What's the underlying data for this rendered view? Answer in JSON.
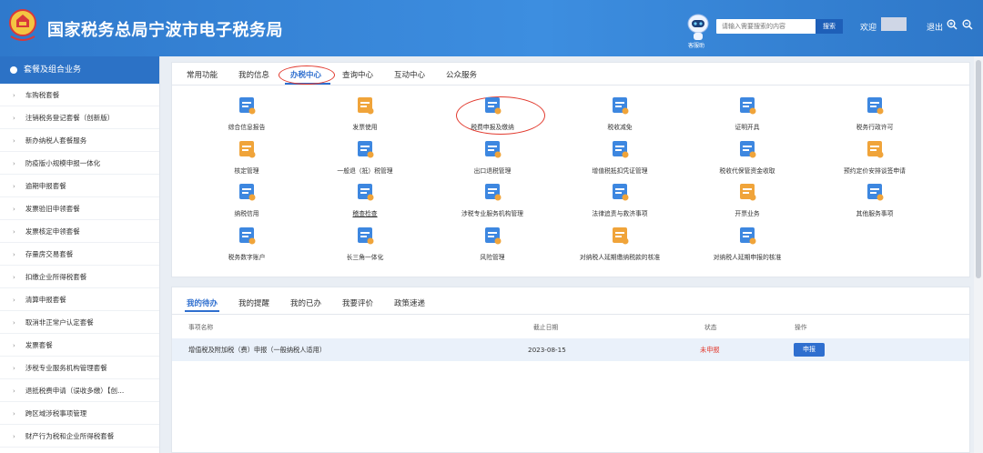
{
  "header": {
    "title": "国家税务总局宁波市电子税务局",
    "robot_label": "客服助",
    "search_placeholder": "请输入需要搜索的内容",
    "search_button": "搜索",
    "welcome": "欢迎",
    "logout": "退出",
    "brand_color": "#2f79cc"
  },
  "sidebar": {
    "heading": "套餐及组合业务",
    "items": [
      "车购税套餐",
      "注销税务登记套餐（创新版）",
      "新办纳税人套餐服务",
      "防疫版小规模申报一体化",
      "逾期申报套餐",
      "发票验旧申领套餐",
      "发票核定申领套餐",
      "存量房交易套餐",
      "扣缴企业所得税套餐",
      "清算申报套餐",
      "取消非正常户认定套餐",
      "发票套餐",
      "涉税专业服务机构管理套餐",
      "退抵税费申请（误收多缴）【创...",
      "跨区域涉税事项管理",
      "财产行为税和企业所得税套餐"
    ]
  },
  "tabs": [
    "常用功能",
    "我的信息",
    "办税中心",
    "查询中心",
    "互动中心",
    "公众服务"
  ],
  "services": [
    "综合信息报告",
    "发票使用",
    "税费申报及缴纳",
    "税收减免",
    "证明开具",
    "税务行政许可",
    "核定管理",
    "一般退（抵）税管理",
    "出口退税管理",
    "增值税抵扣凭证管理",
    "税收代保管资金收取",
    "预约定价安排谈签申请",
    "纳税信用",
    "稽查检查",
    "涉税专业服务机构管理",
    "法律追责与救济事项",
    "开票业务",
    "其他服务事项",
    "税务数字账户",
    "长三角一体化",
    "风险管理",
    "对纳税人延期缴纳税款的核准",
    "对纳税人延期申报的核准"
  ],
  "todo": {
    "tabs": [
      "我的待办",
      "我的提醒",
      "我的已办",
      "我要评价",
      "政策速递"
    ],
    "columns": [
      "事项名称",
      "截止日期",
      "状态",
      "操作"
    ],
    "rows": [
      {
        "name": "增值税及附加税（费）申报（一般纳税人适用）",
        "deadline": "2023-08-15",
        "status": "未申报",
        "action": "申报"
      }
    ]
  }
}
